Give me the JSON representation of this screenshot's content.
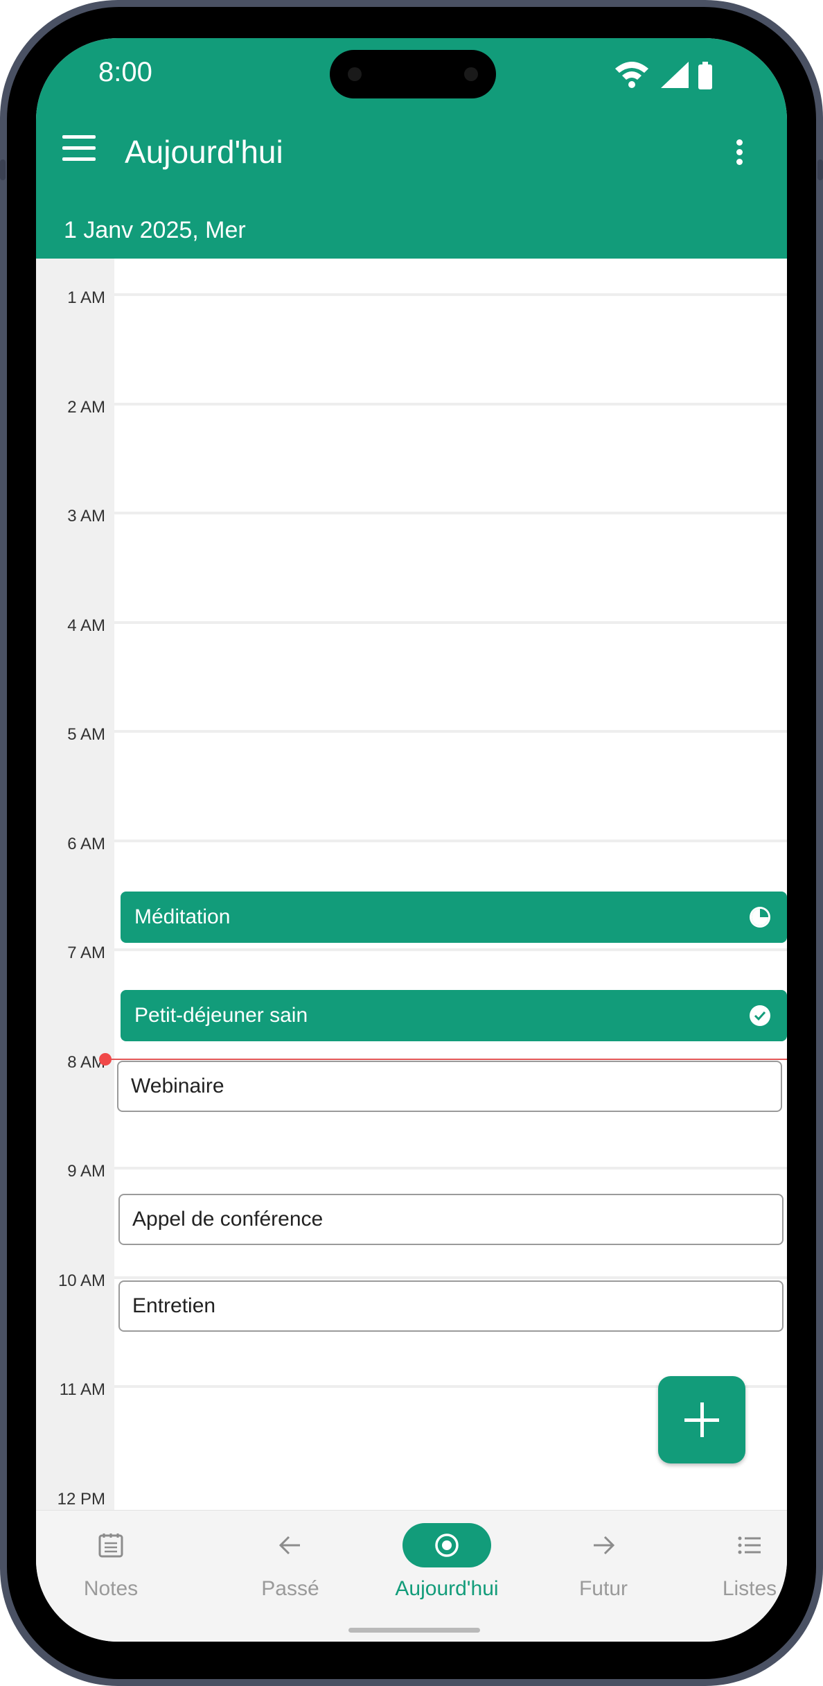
{
  "status_bar": {
    "time": "8:00"
  },
  "app_bar": {
    "title": "Aujourd'hui",
    "date": "1 Janv 2025, Mer"
  },
  "timeline": {
    "hours": [
      "1 AM",
      "2 AM",
      "3 AM",
      "4 AM",
      "5 AM",
      "6 AM",
      "7 AM",
      "8 AM",
      "9 AM",
      "10 AM",
      "11 AM",
      "12 PM"
    ],
    "events": [
      {
        "title": "Méditation",
        "style": "filled",
        "status_icon": "pie-progress-icon"
      },
      {
        "title": "Petit-déjeuner sain",
        "style": "filled",
        "status_icon": "check-circle-icon"
      },
      {
        "title": "Webinaire",
        "style": "outline"
      },
      {
        "title": "Appel de conférence",
        "style": "outline"
      },
      {
        "title": "Entretien",
        "style": "outline"
      }
    ]
  },
  "bottom_nav": {
    "items": [
      {
        "label": "Notes",
        "icon": "notes-icon",
        "active": false
      },
      {
        "label": "Passé",
        "icon": "arrow-left-icon",
        "active": false
      },
      {
        "label": "Aujourd'hui",
        "icon": "today-target-icon",
        "active": true
      },
      {
        "label": "Futur",
        "icon": "arrow-right-icon",
        "active": false
      },
      {
        "label": "Listes",
        "icon": "list-icon",
        "active": false
      }
    ]
  },
  "colors": {
    "accent": "#129c7a",
    "now_indicator": "#f04848"
  }
}
